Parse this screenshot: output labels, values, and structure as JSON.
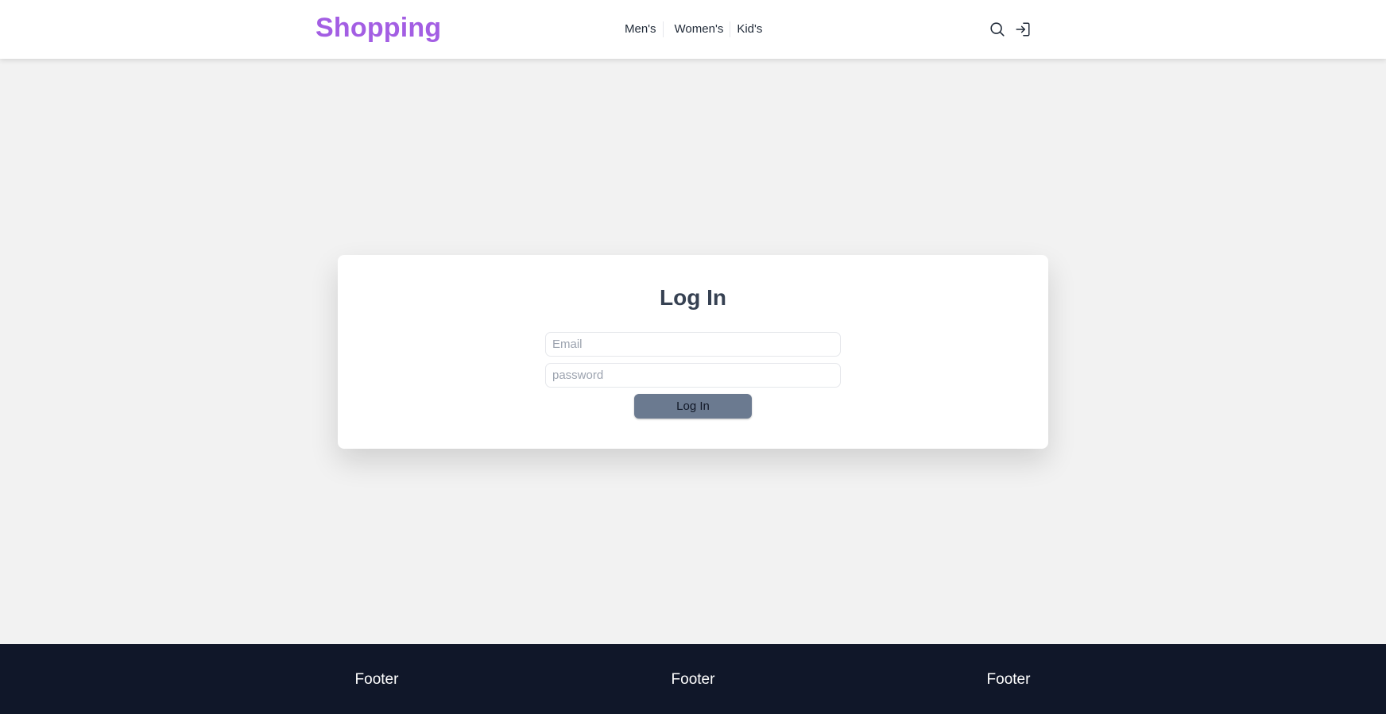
{
  "header": {
    "brand": "Shopping",
    "nav": [
      {
        "label": "Men's"
      },
      {
        "label": "Women's"
      },
      {
        "label": "Kid's"
      }
    ],
    "icons": [
      "search-icon",
      "sign-in-icon"
    ],
    "brand_color": "#a35ee3"
  },
  "login": {
    "title": "Log In",
    "email_placeholder": "Email",
    "email_value": "",
    "password_placeholder": "password",
    "password_value": "",
    "button_label": "Log In",
    "button_color": "#6b7a90"
  },
  "footer": {
    "columns": [
      {
        "label": "Footer"
      },
      {
        "label": "Footer"
      },
      {
        "label": "Footer"
      }
    ],
    "background": "#101729"
  }
}
